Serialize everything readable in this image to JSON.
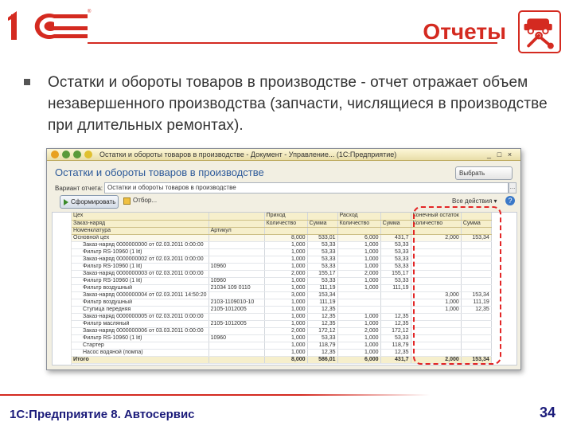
{
  "slide": {
    "title": "Отчеты",
    "bullet": "Остатки и обороты товаров в производстве  - отчет отражает объем незавершенного производства (запчасти, числящиеся в производстве при длительных ремонтах).",
    "footer": "1С:Предприятие 8. Автосервис",
    "page": "34",
    "brand": "1С"
  },
  "colors": {
    "accent": "#d42a20",
    "footer_text": "#1b1b7a"
  },
  "window": {
    "title": "Остатки и обороты товаров в производстве - Документ - Управление... (1С:Предприятие)",
    "form_title": "Остатки и обороты товаров в производстве",
    "choose_variant": "Выбрать вариант...",
    "variant_label": "Вариант отчета:",
    "variant_value": "Остатки и обороты товаров в производстве",
    "form_button": "Сформировать",
    "sheet_button": "Отбор...",
    "all_actions": "Все действия ▾",
    "help": "?"
  },
  "grid": {
    "header1": [
      "Цех",
      "",
      "Приход",
      "",
      "Расход",
      "",
      "Конечный остаток",
      ""
    ],
    "header2": [
      "Заказ-наряд",
      "",
      "Количество",
      "Сумма",
      "Количество",
      "Сумма",
      "Количество",
      "Сумма"
    ],
    "header3": [
      "Номенклатура",
      "Артикул",
      "",
      "",
      "",
      "",
      "",
      ""
    ],
    "rows": [
      {
        "kind": "group",
        "cells": [
          "Основной цех",
          "",
          "8,000",
          "533,01",
          "6,000",
          "431,7",
          "2,000",
          "153,34"
        ]
      },
      {
        "kind": "item",
        "cells": [
          "Заказ-наряд 0000000000 от 02.03.2011 0:00:00",
          "",
          "1,000",
          "53,33",
          "1,000",
          "53,33",
          "",
          ""
        ]
      },
      {
        "kind": "item",
        "cells": [
          "Фильтр RS-10960 (1 lit)",
          "",
          "1,000",
          "53,33",
          "1,000",
          "53,33",
          "",
          ""
        ]
      },
      {
        "kind": "item",
        "cells": [
          "Заказ-наряд 0000000002 от 02.03.2011 0:00:00",
          "",
          "1,000",
          "53,33",
          "1,000",
          "53,33",
          "",
          ""
        ]
      },
      {
        "kind": "item",
        "cells": [
          "Фильтр RS-10960 (1 lit)",
          "10960",
          "1,000",
          "53,33",
          "1,000",
          "53,33",
          "",
          ""
        ]
      },
      {
        "kind": "item",
        "cells": [
          "Заказ-наряд 0000000003 от 02.03.2011 0:00:00",
          "",
          "2,000",
          "155,17",
          "2,000",
          "155,17",
          "",
          ""
        ]
      },
      {
        "kind": "item",
        "cells": [
          "Фильтр RS-10960 (1 lit)",
          "10960",
          "1,000",
          "53,33",
          "1,000",
          "53,33",
          "",
          ""
        ]
      },
      {
        "kind": "item",
        "cells": [
          "Фильтр воздушный",
          "21034 109 0110",
          "1,000",
          "111,19",
          "1,000",
          "111,19",
          "",
          ""
        ]
      },
      {
        "kind": "item",
        "cells": [
          "Заказ-наряд 0000000004 от 02.03.2011 14:50:20",
          "",
          "3,000",
          "153,34",
          "",
          "",
          "3,000",
          "153,34"
        ]
      },
      {
        "kind": "item",
        "cells": [
          "Фильтр воздушный",
          "2103-1109010-10",
          "1,000",
          "111,19",
          "",
          "",
          "1,000",
          "111,19"
        ]
      },
      {
        "kind": "item",
        "cells": [
          "Ступица передняя",
          "2105-1012005",
          "1,000",
          "12,35",
          "",
          "",
          "1,000",
          "12,35"
        ]
      },
      {
        "kind": "item",
        "cells": [
          "Заказ-наряд 0000000005 от 02.03.2011 0:00:00",
          "",
          "1,000",
          "12,35",
          "1,000",
          "12,35",
          "",
          ""
        ]
      },
      {
        "kind": "item",
        "cells": [
          "Фильтр масляный",
          "2105-1012005",
          "1,000",
          "12,35",
          "1,000",
          "12,35",
          "",
          ""
        ]
      },
      {
        "kind": "item",
        "cells": [
          "Заказ-наряд 0000000006 от 03.03.2011 0:00:00",
          "",
          "2,000",
          "172,12",
          "2,000",
          "172,12",
          "",
          ""
        ]
      },
      {
        "kind": "item",
        "cells": [
          "Фильтр RS-10960 (1 lit)",
          "10960",
          "1,000",
          "53,33",
          "1,000",
          "53,33",
          "",
          ""
        ]
      },
      {
        "kind": "item",
        "cells": [
          "Стартер",
          "",
          "1,000",
          "118,79",
          "1,000",
          "118,79",
          "",
          ""
        ]
      },
      {
        "kind": "item",
        "cells": [
          "Насос водяной (помпа)",
          "",
          "1,000",
          "12,35",
          "1,000",
          "12,35",
          "",
          ""
        ]
      }
    ],
    "total": [
      "Итого",
      "",
      "8,000",
      "586,01",
      "6,000",
      "431,7",
      "2,000",
      "153,34"
    ]
  }
}
